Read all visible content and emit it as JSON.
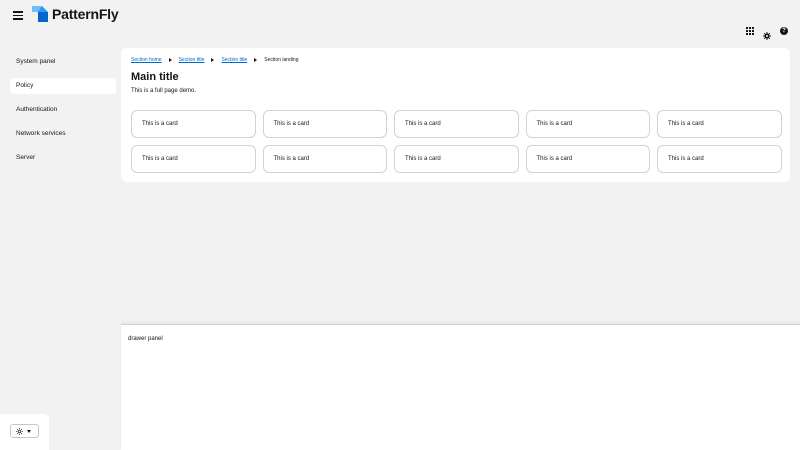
{
  "brand": {
    "name": "PatternFly",
    "logo_colors": [
      "#2b9af3",
      "#0066cc",
      "#73bcf7"
    ]
  },
  "masthead": {
    "tools": [
      {
        "icon": "grid-icon"
      },
      {
        "icon": "gear-icon"
      },
      {
        "icon": "help-icon"
      }
    ]
  },
  "sidebar": {
    "items": [
      {
        "label": "System panel",
        "active": false
      },
      {
        "label": "Policy",
        "active": true
      },
      {
        "label": "Authentication",
        "active": false
      },
      {
        "label": "Network services",
        "active": false
      },
      {
        "label": "Server",
        "active": false
      }
    ]
  },
  "breadcrumb": {
    "items": [
      {
        "label": "Section home",
        "link": true
      },
      {
        "label": "Section title",
        "link": true
      },
      {
        "label": "Section title",
        "link": true
      },
      {
        "label": "Section landing",
        "link": false
      }
    ]
  },
  "main": {
    "title": "Main title",
    "description": "This is a full page demo.",
    "cards": [
      "This is a card",
      "This is a card",
      "This is a card",
      "This is a card",
      "This is a card",
      "This is a card",
      "This is a card",
      "This is a card",
      "This is a card",
      "This is a card"
    ]
  },
  "drawer": {
    "text": "drawer panel"
  },
  "colors": {
    "link": "#0066cc",
    "background": "#f2f2f2",
    "surface": "#ffffff",
    "border": "#d2d2d2"
  }
}
